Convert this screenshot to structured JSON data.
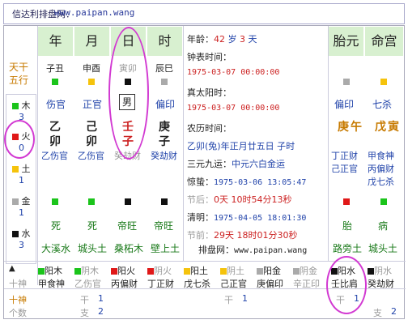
{
  "top": {
    "title": "信达利排盘网：",
    "site": "www.paipan.wang"
  },
  "headers": {
    "year": "年",
    "month": "月",
    "day": "日",
    "hour": "时",
    "taiyuan": "胎元",
    "minggong": "命宫"
  },
  "left": {
    "tiangan": "天干",
    "wuxing": "五行",
    "mu": "木",
    "mu_n": "3",
    "huo": "火",
    "huo_n": "0",
    "tu": "土",
    "tu_n": "1",
    "jin": "金",
    "jin_n": "1",
    "shui": "水",
    "shui_n": "3"
  },
  "pillars": {
    "tengan": [
      "子丑",
      "申酉",
      "寅卯",
      "辰巳"
    ],
    "shishen": [
      "伤官",
      "正官",
      "男",
      "偏印"
    ],
    "gan": [
      "乙",
      "己",
      "壬",
      "庚"
    ],
    "zhi": [
      "卯",
      "卯",
      "子",
      "子"
    ],
    "cang": [
      "乙伤官",
      "乙伤官",
      "癸劫财",
      "癸劫财"
    ],
    "state": [
      "死",
      "死",
      "帝旺",
      "帝旺"
    ],
    "nayin": [
      "大溪水",
      "城头土",
      "桑柘木",
      "壁上土"
    ]
  },
  "info": {
    "age_label": "年龄：",
    "age_num": "42",
    "age_unit": "岁",
    "age_days": "3",
    "age_days_unit": "天",
    "clock_label": "钟表时间：",
    "clock_val": "1975-03-07  00:00:00",
    "solar_label": "真太阳时：",
    "solar_val": "1975-03-07  00:00:00",
    "lunar_label": "农历时间：",
    "lunar_val": "乙卯(兔)年正月廿五日 子时",
    "sanyuan_label": "三元九运：",
    "sanyuan_val": "中元六白金运",
    "jingzhe_label": "惊蛰：",
    "jingzhe_val": "1975-03-06  13:05:47",
    "jiehou_label": "节后：",
    "jiehou_val": "0天 10时54分13秒",
    "qingming_label": "清明：",
    "qingming_val": "1975-04-05  18:01:30",
    "jieqian_label": "节前：",
    "jieqian_val": "29天 18时01分30秒",
    "site_label": "排盘网：",
    "site_val": "www.paipan.wang"
  },
  "taiyuan": {
    "shishen": "偏印",
    "gan": "庚",
    "zhi": "午",
    "cang1": "丁正财",
    "cang2": "己正官",
    "state": "胎",
    "nayin": "路旁土"
  },
  "minggong": {
    "shishen": "七杀",
    "gan": "戊",
    "zhi": "寅",
    "cang1": "甲食神",
    "cang2": "丙偏财",
    "cang3": "戊七杀",
    "state": "病",
    "nayin": "城头土"
  },
  "bottom": {
    "shishen_label": "十神",
    "shishen_label2": "个数",
    "cells": [
      {
        "top": "阳木",
        "bottom": "甲食神"
      },
      {
        "top": "阴木",
        "bottom": "乙伤官"
      },
      {
        "top": "阳火",
        "bottom": "丙偏财"
      },
      {
        "top": "阴火",
        "bottom": "丁正财"
      },
      {
        "top": "阳土",
        "bottom": "戊七杀"
      },
      {
        "top": "阴土",
        "bottom": "己正官"
      },
      {
        "top": "阳金",
        "bottom": "庚偏印"
      },
      {
        "top": "阴金",
        "bottom": "辛正印"
      },
      {
        "top": "阳水",
        "bottom": "壬比肩"
      },
      {
        "top": "阴水",
        "bottom": "癸劫财"
      }
    ],
    "counts": [
      {
        "label": "干",
        "n": "1"
      },
      {
        "label": "支",
        "n": "2"
      },
      {
        "label": "干",
        "n": "1"
      },
      {
        "label": "干",
        "n": "1"
      },
      {
        "label": "支",
        "n": "2"
      }
    ]
  }
}
